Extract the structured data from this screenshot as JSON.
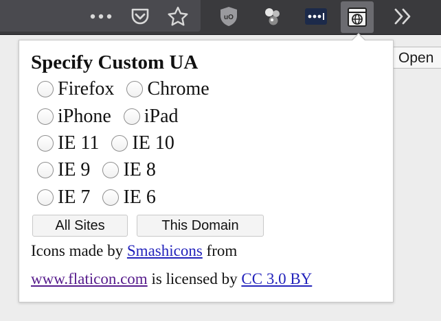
{
  "toolbar": {
    "buttons": [
      "more-icon",
      "pocket-icon",
      "bookmark-star-icon",
      "ublock-icon",
      "extension-dots-icon",
      "password-manager-icon",
      "user-agent-switcher-icon",
      "overflow-chevron-icon"
    ],
    "tooltip_label": "Open"
  },
  "popup": {
    "title": "Specify Custom UA",
    "options": [
      [
        "Firefox",
        "Chrome"
      ],
      [
        "iPhone",
        "iPad"
      ],
      [
        "IE 11",
        "IE 10"
      ],
      [
        "IE 9",
        "IE 8"
      ],
      [
        "IE 7",
        "IE 6"
      ]
    ],
    "buttons": {
      "all_sites": "All Sites",
      "this_domain": "This Domain"
    },
    "credit": {
      "line1_prefix": "Icons made by ",
      "author_link": "Smashicons",
      "line1_suffix": " from",
      "site_link": "www.flaticon.com",
      "line2_middle": " is licensed by ",
      "license_link": "CC 3.0 BY"
    }
  }
}
